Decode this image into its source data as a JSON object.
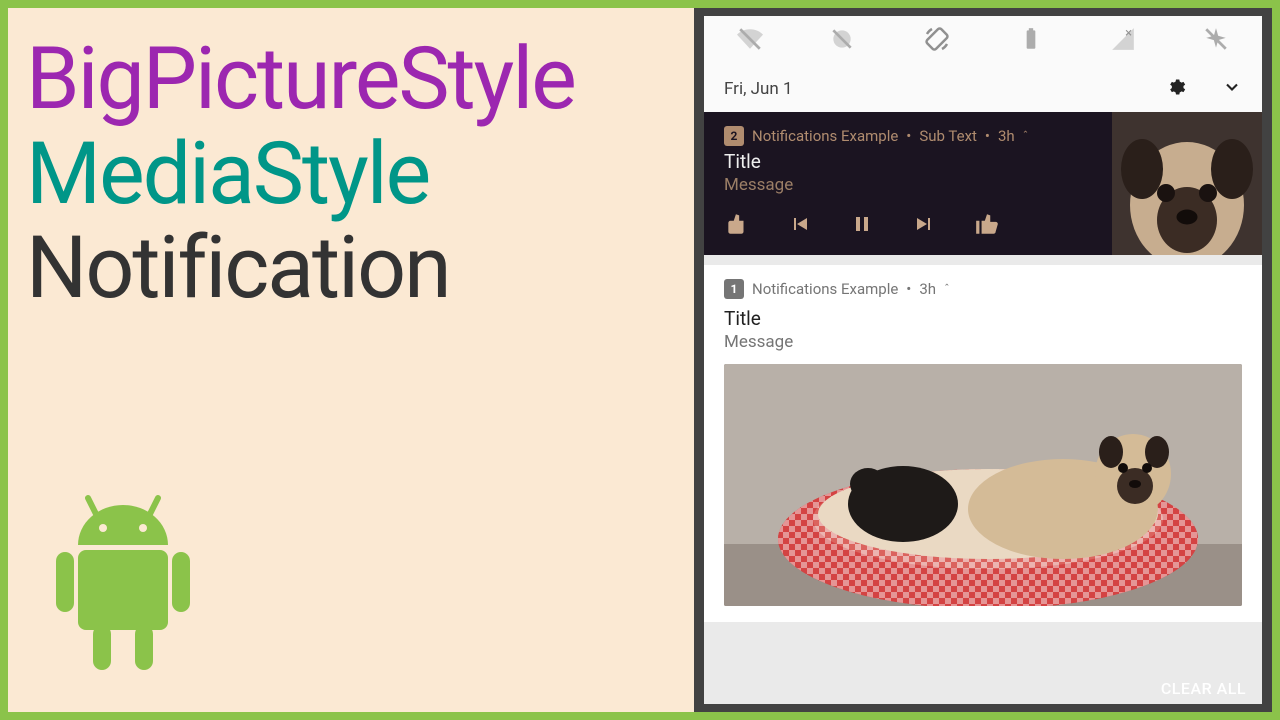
{
  "left": {
    "line1": "BigPictureStyle",
    "line2": "MediaStyle",
    "line3": "Notification"
  },
  "statusbar": {
    "date": "Fri, Jun 1"
  },
  "media": {
    "badge": "2",
    "app": "Notifications Example",
    "sub": "Sub Text",
    "time": "3h",
    "title": "Title",
    "message": "Message"
  },
  "bigpic": {
    "badge": "1",
    "app": "Notifications Example",
    "time": "3h",
    "title": "Title",
    "message": "Message"
  },
  "footer": {
    "clear": "CLEAR ALL"
  }
}
